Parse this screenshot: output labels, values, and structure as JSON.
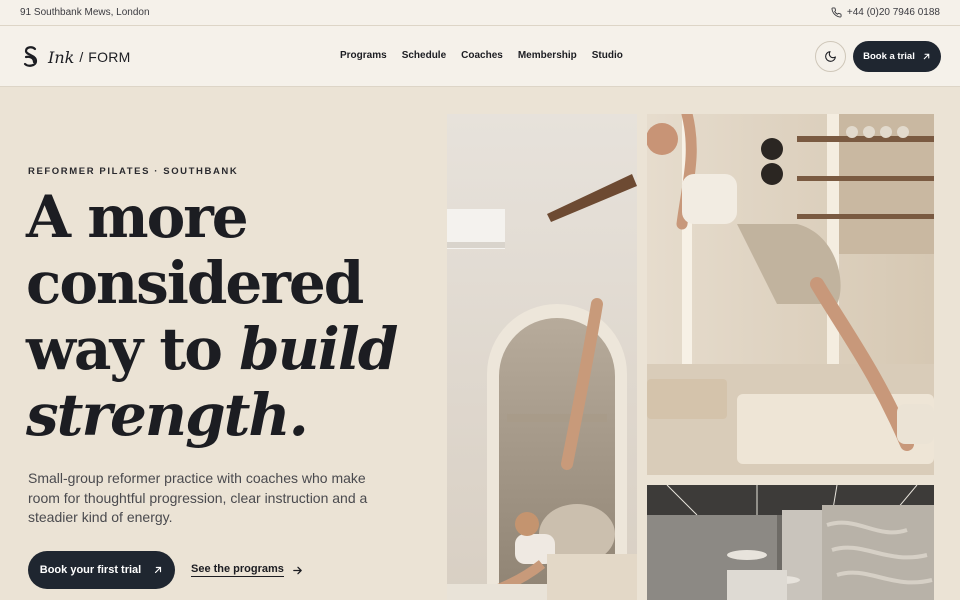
{
  "topbar": {
    "address": "91 Southbank Mews, London",
    "phone": "+44 (0)20 7946 0188",
    "phone_icon": "phone-icon"
  },
  "brand": {
    "name_script": "Ink",
    "separator": "/",
    "name_caps": "FORM",
    "logo_icon": "ink-s-logo-icon"
  },
  "nav": {
    "items": [
      {
        "label": "Programs"
      },
      {
        "label": "Schedule"
      },
      {
        "label": "Coaches"
      },
      {
        "label": "Membership"
      },
      {
        "label": "Studio"
      }
    ],
    "theme_icon": "moon-icon",
    "book_label": "Book a trial",
    "book_icon": "arrow-up-right-icon"
  },
  "hero": {
    "eyebrow": "REFORMER PILATES · SOUTHBANK",
    "headline": {
      "line1": "A more",
      "line2": "considered",
      "line3_regular": "way to ",
      "line3_italic": "build",
      "line4_italic": "strength."
    },
    "subcopy": "Small-group reformer practice with coaches who make room for thoughtful progression, clear instruction and a steadier kind of energy.",
    "cta_primary": "Book your first trial",
    "cta_primary_icon": "arrow-up-right-icon",
    "cta_secondary": "See the programs",
    "cta_secondary_icon": "arrow-right-icon"
  },
  "colors": {
    "background": "#ebe3d5",
    "header": "#f5f1ea",
    "ink": "#1c1d22",
    "button": "#1f2630"
  }
}
